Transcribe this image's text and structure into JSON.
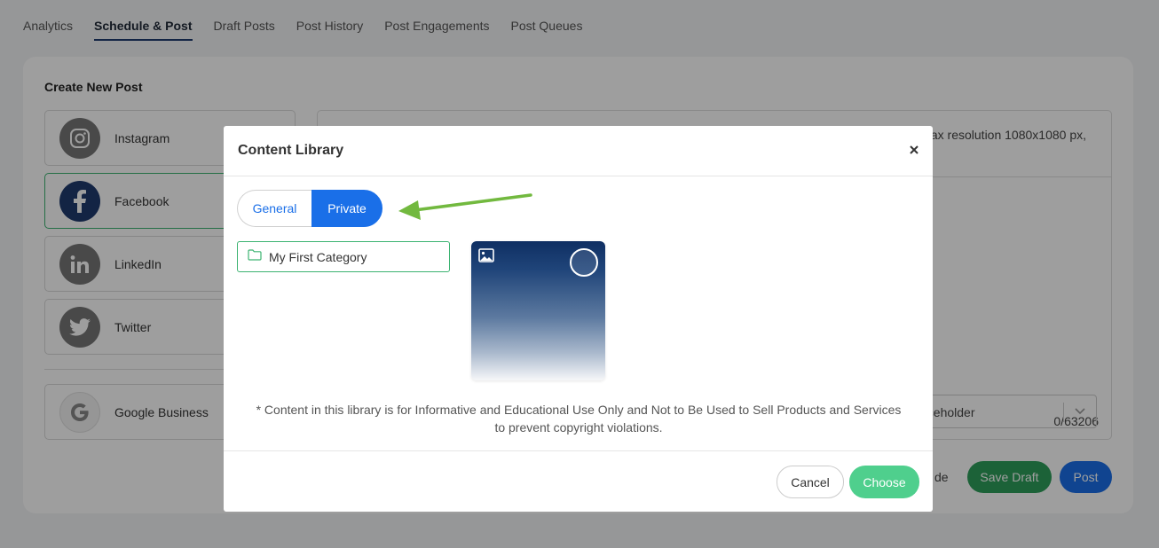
{
  "tabs": [
    "Analytics",
    "Schedule & Post",
    "Draft Posts",
    "Post History",
    "Post Engagements",
    "Post Queues"
  ],
  "active_tab": "Schedule & Post",
  "card": {
    "title": "Create New Post"
  },
  "networks": [
    {
      "label": "Instagram",
      "icon": "instagram-icon",
      "selected": false
    },
    {
      "label": "Facebook",
      "icon": "facebook-icon",
      "selected": true
    },
    {
      "label": "LinkedIn",
      "icon": "linkedin-icon",
      "selected": false
    },
    {
      "label": "Twitter",
      "icon": "twitter-icon",
      "selected": false
    },
    {
      "label": "Google Business",
      "icon": "google-icon",
      "selected": false
    }
  ],
  "compose": {
    "hint": "ax resolution 1080x1080 px,",
    "char_count": "0/63206"
  },
  "select": {
    "placeholder": "aceholder"
  },
  "actions": {
    "peek_text": "de",
    "save_draft": "Save Draft",
    "post": "Post"
  },
  "modal": {
    "title": "Content Library",
    "close_icon": "close-icon",
    "toggle": {
      "general": "General",
      "private": "Private",
      "active": "Private"
    },
    "category": "My First Category",
    "disclaimer": "* Content in this library is for Informative and Educational Use Only and Not to Be Used to Sell Products and Services to prevent copyright violations.",
    "cancel": "Cancel",
    "choose": "Choose"
  },
  "colors": {
    "primary_blue": "#1a6fe8",
    "green": "#2e9e5b",
    "light_green": "#4fcf8d",
    "arrow_green": "#72b93f",
    "facebook_navy": "#1f3a6e"
  }
}
